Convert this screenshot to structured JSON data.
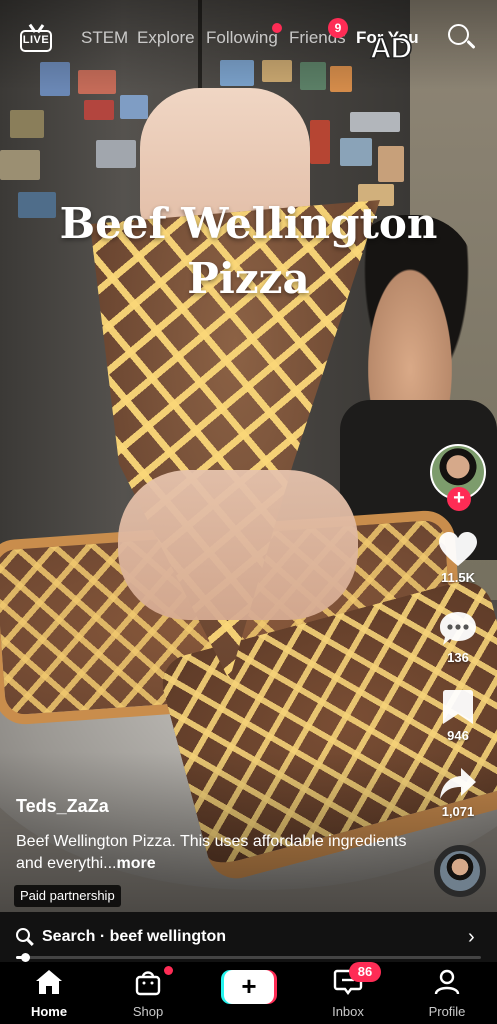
{
  "top_nav": {
    "live_label": "LIVE",
    "tabs": [
      {
        "label": "STEM",
        "active": false
      },
      {
        "label": "Explore",
        "active": false
      },
      {
        "label": "Following",
        "active": false
      },
      {
        "label": "Friends",
        "active": false
      },
      {
        "label": "For You",
        "active": true
      }
    ],
    "friends_badge": "9",
    "ad_label": "AD",
    "icons": {
      "live": "live-tv-icon",
      "search": "search-icon"
    }
  },
  "video": {
    "overlay_title_lines": [
      "Beef Wellington",
      "Pizza"
    ]
  },
  "rail": {
    "likes": "11.5K",
    "comments": "136",
    "bookmarks": "946",
    "shares": "1,071",
    "icons": {
      "like": "heart-icon",
      "comment": "comment-icon",
      "bookmark": "bookmark-icon",
      "share": "share-icon",
      "follow": "plus-icon"
    }
  },
  "caption": {
    "username": "Teds_ZaZa",
    "text": "Beef Wellington Pizza. This uses affordable ingredients and everythi...",
    "more": "more",
    "paid_partnership": "Paid partnership"
  },
  "search_bar": {
    "label": "Search · beef wellington"
  },
  "progress": {
    "fraction": 0.02
  },
  "bottom_nav": {
    "items": [
      {
        "label": "Home",
        "icon": "home-icon",
        "active": true
      },
      {
        "label": "Shop",
        "icon": "shop-bag-icon",
        "active": false
      },
      {
        "label": "",
        "icon": "create-plus-icon",
        "active": false
      },
      {
        "label": "Inbox",
        "icon": "inbox-icon",
        "active": false
      },
      {
        "label": "Profile",
        "icon": "profile-icon",
        "active": false
      }
    ],
    "inbox_badge": "86"
  },
  "colors": {
    "accent_red": "#fe2c55",
    "accent_cyan": "#25f4ee",
    "background": "#000000"
  }
}
